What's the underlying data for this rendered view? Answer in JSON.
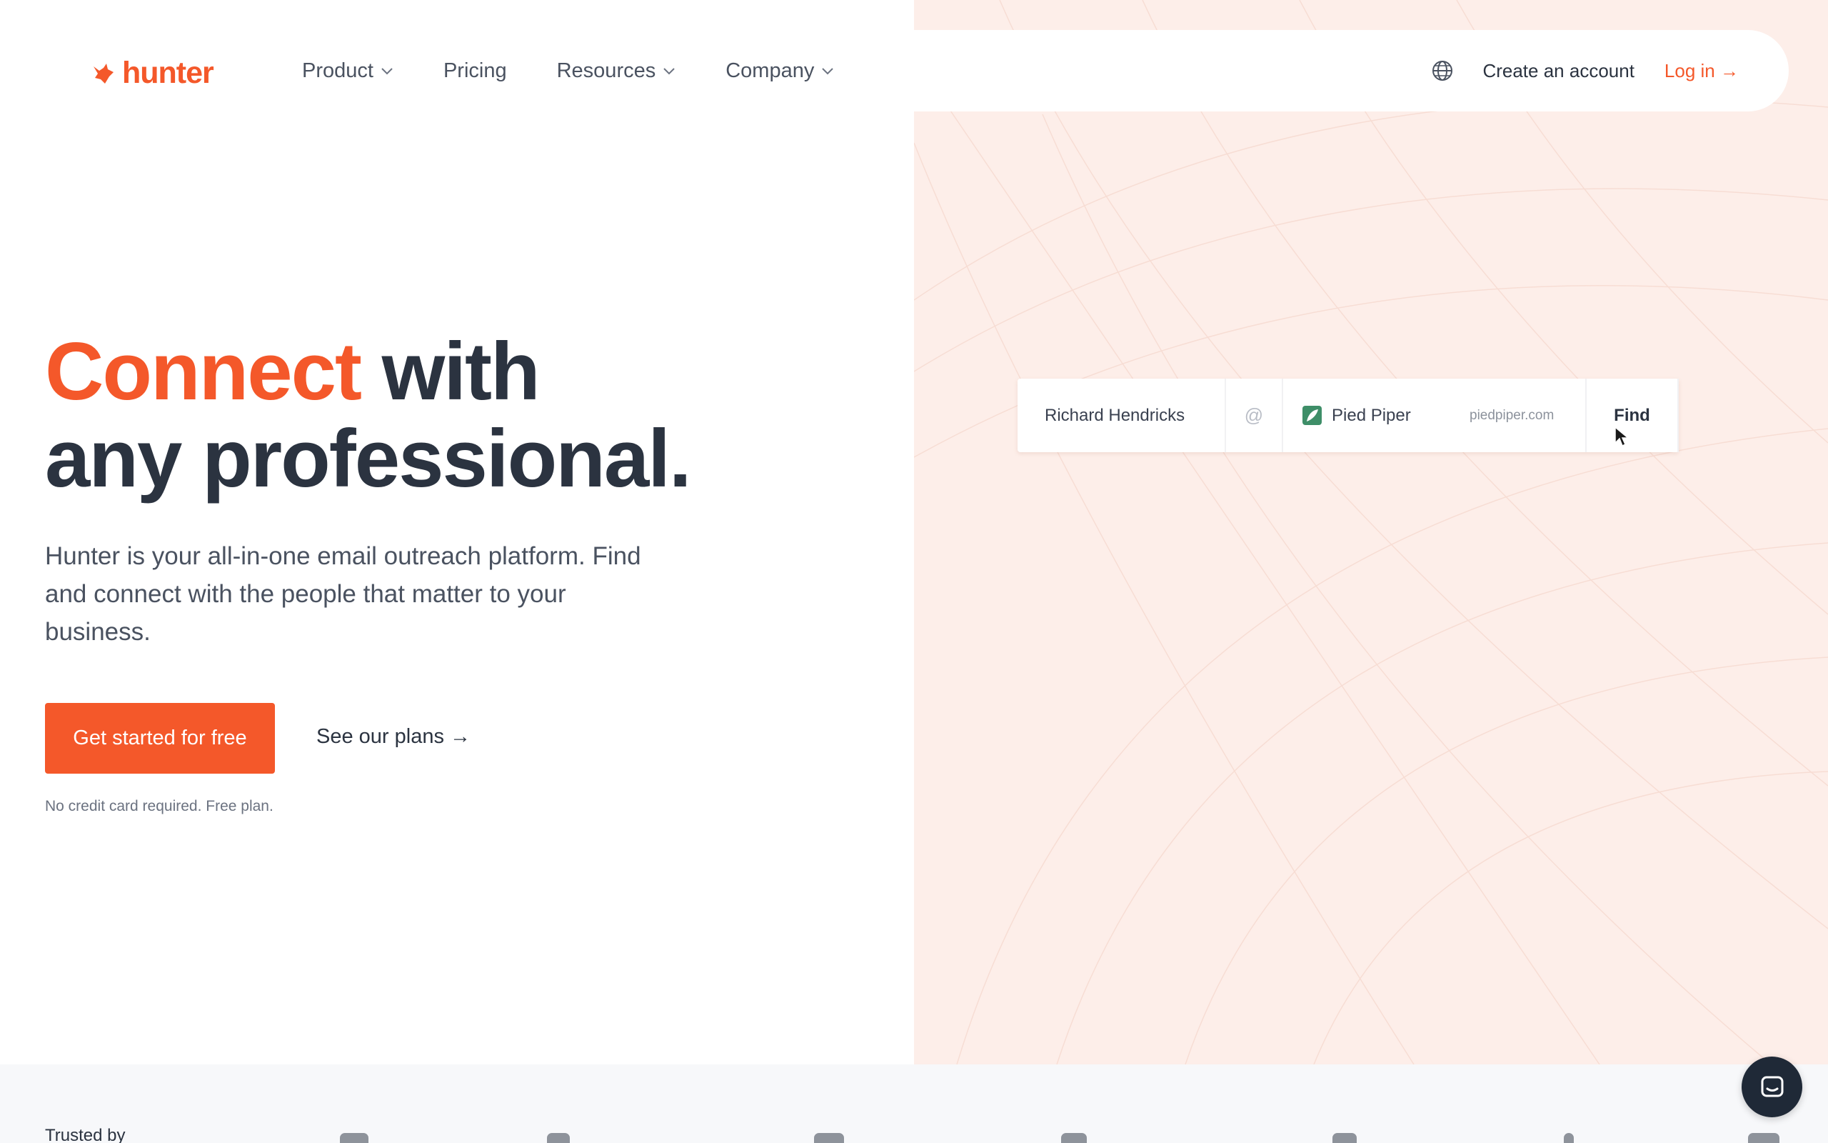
{
  "nav": {
    "brand": "hunter",
    "items": [
      {
        "label": "Product",
        "dropdown": true
      },
      {
        "label": "Pricing",
        "dropdown": false
      },
      {
        "label": "Resources",
        "dropdown": true
      },
      {
        "label": "Company",
        "dropdown": true
      }
    ],
    "create_account": "Create an account",
    "login": "Log in →",
    "icons": {
      "language": "globe-icon",
      "dropdown": "chevron-down-icon"
    }
  },
  "hero": {
    "title_accent": "Connect",
    "title_rest_line1": " with",
    "title_line2": "any professional.",
    "description": "Hunter is your all-in-one email outreach platform. Find and connect with the people that matter to your business.",
    "cta_primary": "Get started for free",
    "cta_secondary": "See our plans →",
    "note": "No credit card required. Free plan."
  },
  "finder": {
    "name": "Richard Hendricks",
    "at": "@",
    "company": "Pied Piper",
    "domain": "piedpiper.com",
    "button": "Find"
  },
  "trusted": {
    "label": "Trusted by"
  },
  "colors": {
    "accent": "#f4582a",
    "text_dark": "#2b3340",
    "panel_bg": "#fdeee9",
    "chat_bg": "#1f2937"
  }
}
